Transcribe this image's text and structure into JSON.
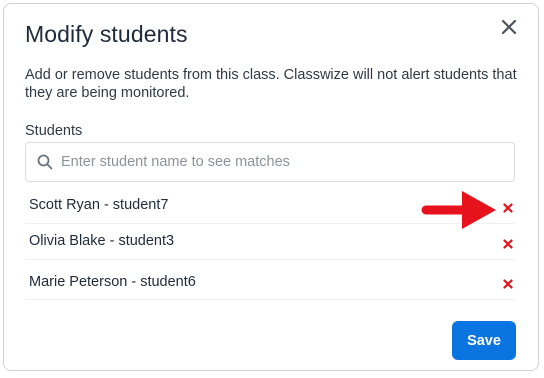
{
  "dialog": {
    "title": "Modify students",
    "description": "Add or remove students from this class. Classwize will not alert students that they are being monitored.",
    "close_icon": "close-icon"
  },
  "students_field": {
    "label": "Students",
    "search_placeholder": "Enter student name to see matches",
    "search_value": "",
    "search_icon": "search-icon"
  },
  "students": [
    {
      "name": "Scott Ryan - student7",
      "remove_icon": "remove-x-icon"
    },
    {
      "name": "Olivia Blake - student3",
      "remove_icon": "remove-x-icon"
    },
    {
      "name": "Marie Peterson - student6",
      "remove_icon": "remove-x-icon"
    }
  ],
  "annotation": {
    "arrow_icon": "red-arrow-icon",
    "color": "#e8121c"
  },
  "footer": {
    "save_label": "Save"
  },
  "colors": {
    "primary": "#0a74e0",
    "remove": "#e8121c",
    "title": "#1d2a3b",
    "text": "#2f3a47"
  }
}
